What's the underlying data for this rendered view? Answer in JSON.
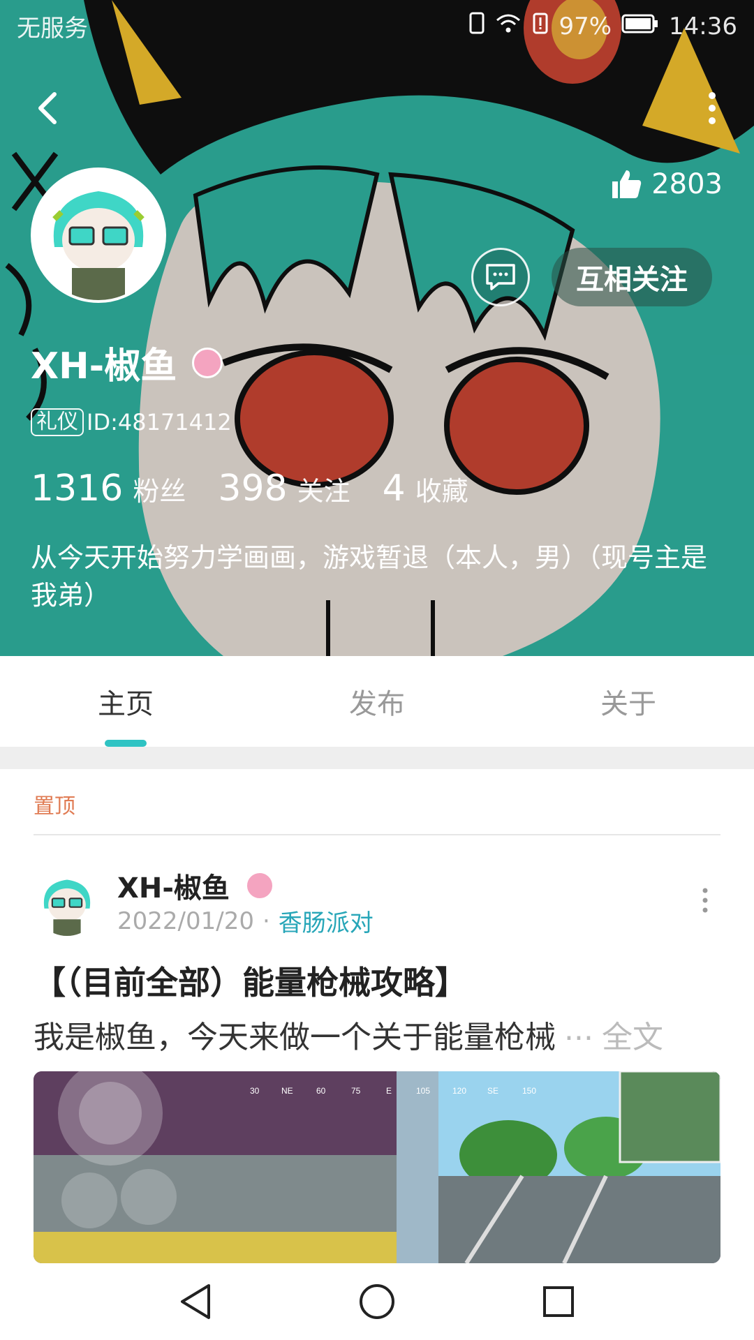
{
  "status_bar": {
    "carrier": "无服务",
    "battery": "97%",
    "time": "14:36"
  },
  "profile": {
    "likes_count": "2803",
    "follow_label": "互相关注",
    "nickname": "XH-椒鱼",
    "uid_tag": "礼仪",
    "uid": "ID:48171412",
    "stats": [
      {
        "value": "1316",
        "label": "粉丝"
      },
      {
        "value": "398",
        "label": "关注"
      },
      {
        "value": "4",
        "label": "收藏"
      }
    ],
    "bio": "从今天开始努力学画画，游戏暂退（本人，男）（现号主是我弟）"
  },
  "tabs": [
    {
      "label": "主页",
      "active": true
    },
    {
      "label": "发布",
      "active": false
    },
    {
      "label": "关于",
      "active": false
    }
  ],
  "post": {
    "pinned_label": "置顶",
    "author": "XH-椒鱼",
    "date": "2022/01/20",
    "separator": "·",
    "topic": "香肠派对",
    "title": "【（目前全部）能量枪械攻略】",
    "excerpt": "我是椒鱼，今天来做一个关于能量枪械",
    "ellipsis": "...",
    "read_more": "全文",
    "compass_labels": [
      "30",
      "NE",
      "60",
      "75",
      "E",
      "105",
      "120",
      "SE",
      "150"
    ]
  },
  "colors": {
    "header_bg": "#2fb2a0",
    "accent": "#2fc3c3",
    "topic": "#27a6b8",
    "pinned": "#e07b53"
  },
  "icons": {
    "back": "chevron-left-icon",
    "more": "vertical-dots-icon",
    "like": "thumbs-up-icon",
    "chat": "message-bubble-icon",
    "nav_back": "triangle-back-icon",
    "nav_home": "circle-home-icon",
    "nav_recents": "square-recents-icon"
  }
}
